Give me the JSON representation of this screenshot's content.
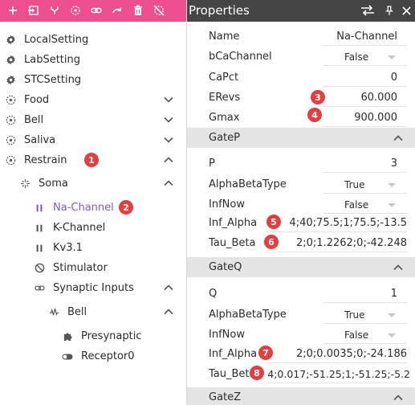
{
  "toolbar": {
    "icons": [
      "plus-icon",
      "import-icon",
      "fork-icon",
      "target-icon",
      "link-icon",
      "redo-icon",
      "trash-icon",
      "no-target-icon"
    ]
  },
  "tree": {
    "local_setting": "LocalSetting",
    "lab_setting": "LabSetting",
    "stc_setting": "STCSetting",
    "food": "Food",
    "bell": "Bell",
    "saliva": "Saliva",
    "restrain": "Restrain",
    "soma": "Soma",
    "na_channel": "Na-Channel",
    "k_channel": "K-Channel",
    "kv31": "Kv3.1",
    "stimulator": "Stimulator",
    "synaptic_inputs": "Synaptic Inputs",
    "bell_child": "Bell",
    "presynaptic": "Presynaptic",
    "receptor0": "Receptor0"
  },
  "badges": [
    "1",
    "2",
    "3",
    "4",
    "5",
    "6",
    "7",
    "8"
  ],
  "properties": {
    "title": "Properties",
    "general": [
      {
        "name": "Name",
        "value": "Na-Channel"
      },
      {
        "name": "bCaChannel",
        "value": "False"
      },
      {
        "name": "CaPct",
        "value": "0"
      },
      {
        "name": "ERevs",
        "value": "60.000"
      },
      {
        "name": "Gmax",
        "value": "900.000"
      }
    ],
    "gatep": {
      "title": "GateP",
      "rows": [
        {
          "name": "P",
          "value": "3"
        },
        {
          "name": "AlphaBetaType",
          "value": "True"
        },
        {
          "name": "InfNow",
          "value": "False"
        },
        {
          "name": "Inf_Alpha",
          "value": "4;40;75.5;1;75.5;-13.5"
        },
        {
          "name": "Tau_Beta",
          "value": "2;0;1.2262;0;-42.248"
        }
      ]
    },
    "gateq": {
      "title": "GateQ",
      "rows": [
        {
          "name": "Q",
          "value": "1"
        },
        {
          "name": "AlphaBetaType",
          "value": "True"
        },
        {
          "name": "InfNow",
          "value": "False"
        },
        {
          "name": "Inf_Alpha",
          "value": "2;0;0.0035;0;-24.186"
        },
        {
          "name": "Tau_Beta",
          "value": "4;0.017;-51.25;1;-51.25;-5.2"
        }
      ]
    },
    "gatez": {
      "title": "GateZ"
    }
  },
  "colors": {
    "toolbar_bg": "#ec4f8c",
    "header_bg": "#454545",
    "section_bg": "#e4e4e4",
    "selected": "#7c5cc4",
    "badge": "#e53e3e"
  }
}
